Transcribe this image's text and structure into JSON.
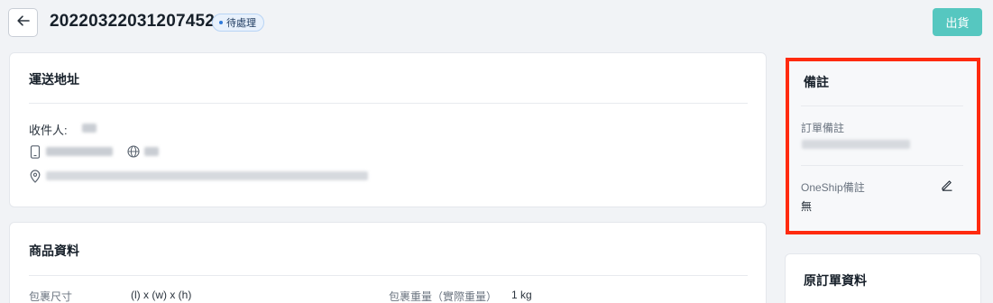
{
  "header": {
    "order_number": "20220322031207452",
    "status": "待處理",
    "ship_label": "出貨"
  },
  "shipping": {
    "title": "運送地址",
    "recipient_label": "收件人:"
  },
  "product": {
    "title": "商品資料",
    "size_label": "包裹尺寸",
    "size_value": "(l) x (w) x (h)",
    "weight_label": "包裹重量（實際重量）",
    "weight_value": "1 kg"
  },
  "notes": {
    "title": "備註",
    "order_note_label": "訂單備註",
    "oneship_note_label": "OneShip備註",
    "oneship_note_value": "無"
  },
  "original": {
    "title": "原訂單資料"
  },
  "colors": {
    "accent": "#56c7c0",
    "highlight": "#ff2a0f",
    "status_dot": "#2f7ad9"
  }
}
